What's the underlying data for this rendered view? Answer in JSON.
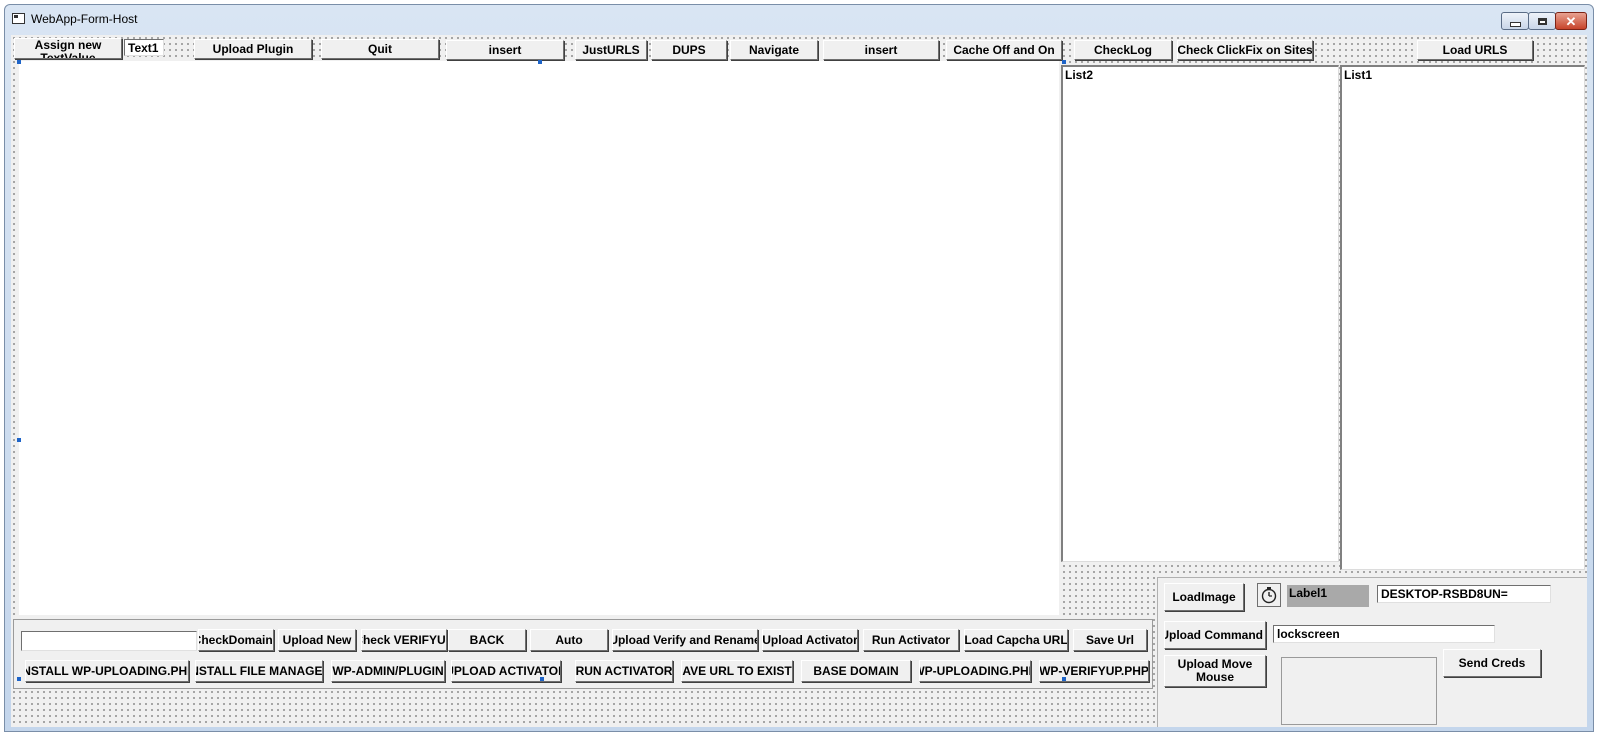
{
  "window": {
    "title": "WebApp-Form-Host"
  },
  "toolbar": {
    "assign_btn": "Assign new TextValue",
    "text1": "Text1",
    "upload_plugin": "Upload Plugin",
    "quit": "Quit",
    "insert1": "insert",
    "just_urls": "JustURLS",
    "dups": "DUPS",
    "navigate": "Navigate",
    "insert2": "insert",
    "cache": "Cache Off and On",
    "check_log": "CheckLog",
    "check_clickfix": "Check ClickFix on Sites",
    "load_urls": "Load URLS"
  },
  "lists": {
    "list2": "List2",
    "list1": "List1"
  },
  "bottom_row1": {
    "domain_input_value": "",
    "check_domains": "CheckDomains",
    "upload_new": "Upload New",
    "check_verifyup": "Check VERIFYUP",
    "back": "BACK",
    "auto": "Auto",
    "upload_verify_rename": "Upload Verify and Rename",
    "upload_activator": "Upload Activator",
    "run_activator": "Run Activator",
    "load_captcha_url": "Load Capcha URL",
    "save_url": "Save Url"
  },
  "bottom_row2": {
    "install_wp_uploading": "INSTALL WP-UPLOADING.PHP",
    "install_file_manager": "INSTALL FILE MANAGER",
    "wp_admin_plugin": "WP-ADMIN/PLUGIN",
    "upload_activator": "UPLOAD ACTIVATOR",
    "run_activator": "RUN ACTIVATOR",
    "save_url_exists": "SAVE URL TO EXISTS",
    "base_domain": "BASE DOMAIN",
    "wp_uploading": "WP-UPLOADING.PHP",
    "wp_verifyup": "WP-VERIFYUP.PHP"
  },
  "right_panel": {
    "load_image": "LoadImage",
    "label1": "Label1",
    "desktop_value": "DESKTOP-RSBD8UN=",
    "upload_command": "Upload Command I",
    "lockscreen_value": "lockscreen",
    "upload_move_mouse": "Upload Move Mouse",
    "send_creds": "Send Creds"
  },
  "icons": {
    "app": "window-app-icon",
    "timer": "stopwatch-icon",
    "minimize": "minimize-icon",
    "maximize": "maximize-icon",
    "close": "close-icon"
  }
}
